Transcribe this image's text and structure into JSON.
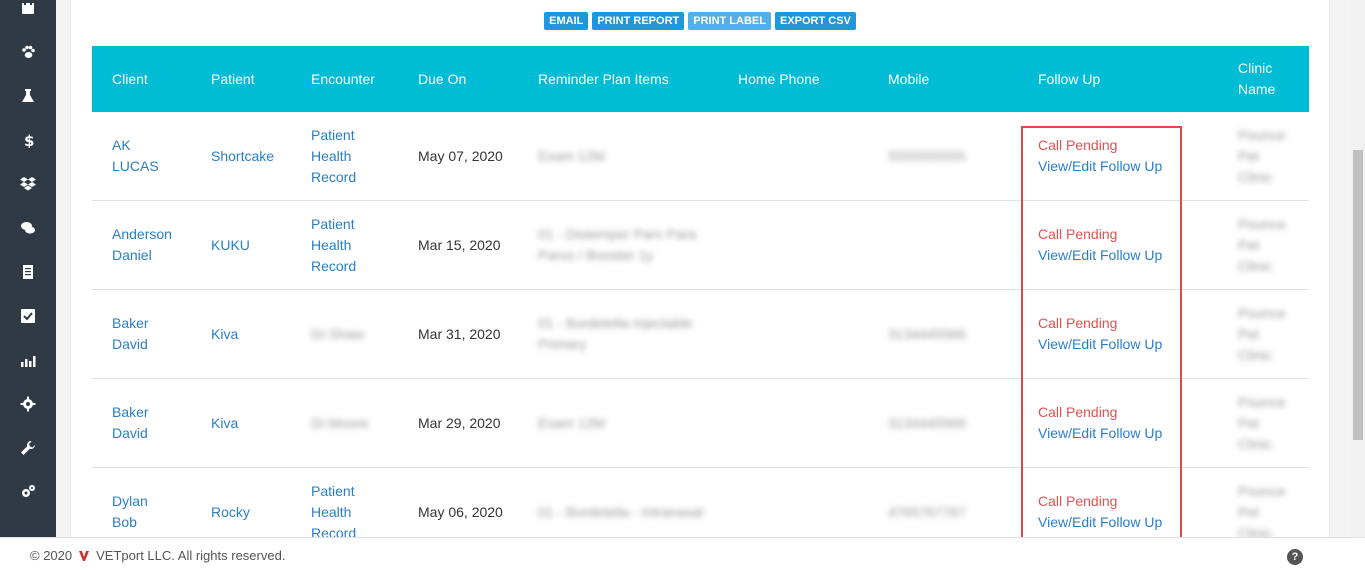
{
  "toolbar": {
    "buttons": [
      "EMAIL",
      "PRINT REPORT",
      "PRINT LABEL",
      "EXPORT CSV"
    ]
  },
  "table": {
    "columns": [
      "Client",
      "Patient",
      "Encounter",
      "Due On",
      "Reminder Plan Items",
      "Home Phone",
      "Mobile",
      "Follow Up",
      "Clinic Name"
    ],
    "rows": [
      {
        "client": "AK LUCAS",
        "patient": "Shortcake",
        "encounter": "Patient Health Record",
        "due": "May 07, 2020",
        "reminder": "Exam 12M",
        "home": "",
        "mobile": "5555555555",
        "status": "Call Pending",
        "action": "View/Edit Follow Up",
        "clinic": "Pounce Pet Clinic"
      },
      {
        "client": "Anderson Daniel",
        "patient": "KUKU",
        "encounter": "Patient Health Record",
        "due": "Mar 15, 2020",
        "reminder": "01 - Distemper Parv Para Parvo / Booster 1y",
        "home": "",
        "mobile": "",
        "status": "Call Pending",
        "action": "View/Edit Follow Up",
        "clinic": "Pounce Pet Clinic"
      },
      {
        "client": "Baker David",
        "patient": "Kiva",
        "encounter": "Dr.Shaw",
        "due": "Mar 31, 2020",
        "reminder": "01 - Bordetella Injectable Primary",
        "home": "",
        "mobile": "3134445566",
        "status": "Call Pending",
        "action": "View/Edit Follow Up",
        "clinic": "Pounce Pet Clinic"
      },
      {
        "client": "Baker David",
        "patient": "Kiva",
        "encounter": "Dr.Moore",
        "due": "Mar 29, 2020",
        "reminder": "Exam 12M",
        "home": "",
        "mobile": "3134445566",
        "status": "Call Pending",
        "action": "View/Edit Follow Up",
        "clinic": "Pounce Pet Clinic"
      },
      {
        "client": "Dylan Bob",
        "patient": "Rocky",
        "encounter": "Patient Health Record",
        "due": "May 06, 2020",
        "reminder": "01 - Bordetella - Intranasal",
        "home": "",
        "mobile": "4765767767",
        "status": "Call Pending",
        "action": "View/Edit Follow Up",
        "clinic": "Pounce Pet Clinic"
      }
    ]
  },
  "footer": {
    "copyright": "© 2020",
    "company": "VETport LLC. All rights reserved.",
    "help": "?"
  },
  "sidebar": {
    "icons": [
      "calendar-icon",
      "paw-icon",
      "flask-icon",
      "dollar-icon",
      "dropbox-icon",
      "chat-icon",
      "document-icon",
      "checklist-icon",
      "chart-icon",
      "gear-icon",
      "wrench-icon",
      "gears-icon"
    ]
  },
  "colors": {
    "header": "#00bcd4",
    "link": "#2a7ec8",
    "pending": "#e05252",
    "button": "#2196d9",
    "sidebar": "#2f3a45"
  }
}
